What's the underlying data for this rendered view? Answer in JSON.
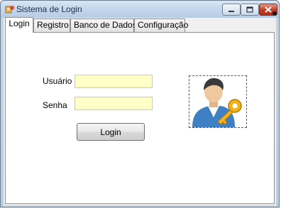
{
  "window": {
    "title": "Sistema de Login",
    "controls": {
      "minimize": "minimize-icon",
      "maximize": "maximize-icon",
      "close": "close-icon"
    }
  },
  "tabs": [
    {
      "label": "Login",
      "active": true
    },
    {
      "label": "Registro",
      "active": false
    },
    {
      "label": "Banco de Dados",
      "active": false
    },
    {
      "label": "Configuração",
      "active": false
    }
  ],
  "login_form": {
    "user_label": "Usuário",
    "user_value": "",
    "password_label": "Senha",
    "password_value": "",
    "submit_label": "Login"
  },
  "picture": {
    "icon": "user-key-icon"
  },
  "colors": {
    "input_background": "#ffffc8",
    "close_button": "#c23b23",
    "titlebar": "#c2d5ec"
  }
}
